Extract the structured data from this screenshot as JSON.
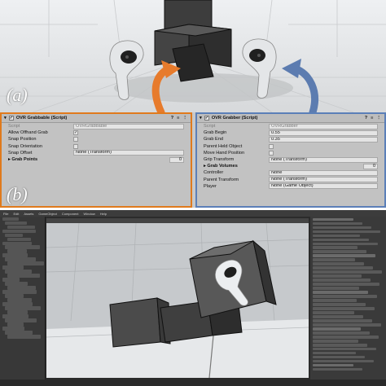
{
  "panel_a": {
    "label": "(a)",
    "colors": {
      "grab_arrow": "#e77b2c",
      "grabber_arrow": "#5c7cb0",
      "cube": "#3b3b3b"
    }
  },
  "panel_b": {
    "label": "(b)",
    "grabbable": {
      "title": "OVR Grabbable (Script)",
      "accent": "#e07a1c",
      "rows": [
        {
          "label": "Script",
          "value": "OVRGrabbable",
          "kind": "ref",
          "dim": true
        },
        {
          "label": "Allow Offhand Grab",
          "value": "✓",
          "kind": "check"
        },
        {
          "label": "Snap Position",
          "value": "",
          "kind": "check"
        },
        {
          "label": "Snap Orientation",
          "value": "",
          "kind": "check"
        },
        {
          "label": "Snap Offset",
          "value": "None (Transform)",
          "kind": "ref"
        },
        {
          "label": "Grab Points",
          "value": "0",
          "kind": "num",
          "bold": true
        }
      ]
    },
    "grabber": {
      "title": "OVR Grabber (Script)",
      "accent": "#5b7fb8",
      "rows": [
        {
          "label": "Script",
          "value": "OVRGrabber",
          "kind": "ref",
          "dim": true
        },
        {
          "label": "Grab Begin",
          "value": "0.55",
          "kind": "text"
        },
        {
          "label": "Grab End",
          "value": "0.35",
          "kind": "text"
        },
        {
          "label": "Parent Held Object",
          "value": "",
          "kind": "check"
        },
        {
          "label": "Move Hand Position",
          "value": "",
          "kind": "check"
        },
        {
          "label": "Grip Transform",
          "value": "None (Transform)",
          "kind": "ref"
        },
        {
          "label": "Grab Volumes",
          "value": "0",
          "kind": "num",
          "bold": true
        },
        {
          "label": "Controller",
          "value": "None",
          "kind": "ref"
        },
        {
          "label": "Parent Transform",
          "value": "None (Transform)",
          "kind": "ref"
        },
        {
          "label": "Player",
          "value": "None (Game Object)",
          "kind": "ref"
        }
      ]
    }
  },
  "panel_c": {
    "menu": [
      "File",
      "Edit",
      "Assets",
      "GameObject",
      "Component",
      "Window",
      "Help"
    ]
  }
}
